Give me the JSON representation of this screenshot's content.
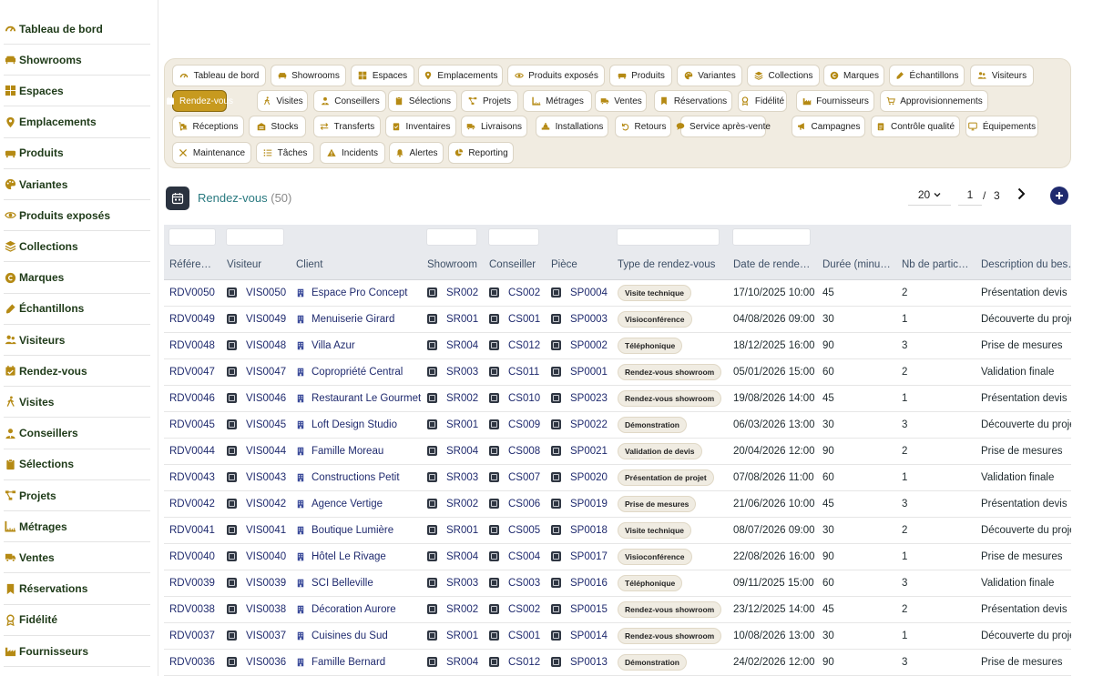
{
  "sidebar": {
    "items": [
      {
        "label": "Tableau de bord",
        "icon": "gauge-icon"
      },
      {
        "label": "Showrooms",
        "icon": "sofa-icon"
      },
      {
        "label": "Espaces",
        "icon": "grid-icon"
      },
      {
        "label": "Emplacements",
        "icon": "map-pin-icon"
      },
      {
        "label": "Produits",
        "icon": "couch-icon"
      },
      {
        "label": "Variantes",
        "icon": "palette-icon"
      },
      {
        "label": "Produits exposés",
        "icon": "eye-icon"
      },
      {
        "label": "Collections",
        "icon": "layers-icon"
      },
      {
        "label": "Marques",
        "icon": "copyright-icon"
      },
      {
        "label": "Échantillons",
        "icon": "eyedropper-icon"
      },
      {
        "label": "Visiteurs",
        "icon": "users-icon"
      },
      {
        "label": "Rendez-vous",
        "icon": "calendar-check-icon"
      },
      {
        "label": "Visites",
        "icon": "walking-icon"
      },
      {
        "label": "Conseillers",
        "icon": "user-tie-icon"
      },
      {
        "label": "Sélections",
        "icon": "clipboard-icon"
      },
      {
        "label": "Projets",
        "icon": "project-diagram-icon"
      },
      {
        "label": "Métrages",
        "icon": "ruler-icon"
      },
      {
        "label": "Ventes",
        "icon": "truck-icon"
      },
      {
        "label": "Réservations",
        "icon": "bookmark-icon"
      },
      {
        "label": "Fidélité",
        "icon": "award-icon"
      },
      {
        "label": "Fournisseurs",
        "icon": "industry-icon"
      }
    ]
  },
  "tabs": {
    "rows": [
      [
        {
          "label": "Tableau de bord",
          "icon": "gauge-icon"
        },
        {
          "label": "Showrooms",
          "icon": "sofa-icon"
        },
        {
          "label": "Espaces",
          "icon": "grid-icon"
        },
        {
          "label": "Emplacements",
          "icon": "map-pin-icon"
        },
        {
          "label": "Produits exposés",
          "icon": "eye-icon"
        },
        {
          "label": "Produits",
          "icon": "couch-icon"
        },
        {
          "label": "Variantes",
          "icon": "palette-icon"
        },
        {
          "label": "Collections",
          "icon": "layers-icon"
        },
        {
          "label": "Marques",
          "icon": "copyright-icon"
        },
        {
          "label": "Échantillons",
          "icon": "eyedropper-icon"
        },
        {
          "label": "Visiteurs",
          "icon": "users-icon"
        }
      ],
      [
        {
          "label": "Rendez-vous",
          "icon": "calendar-check-icon",
          "active": true
        },
        {
          "label": "Visites",
          "icon": "walking-icon"
        },
        {
          "label": "Conseillers",
          "icon": "user-tie-icon"
        },
        {
          "label": "Sélections",
          "icon": "clipboard-icon"
        },
        {
          "label": "Projets",
          "icon": "project-diagram-icon"
        },
        {
          "label": "Métrages",
          "icon": "ruler-icon"
        },
        {
          "label": "Ventes",
          "icon": "truck-icon"
        },
        {
          "label": "Réservations",
          "icon": "bookmark-icon"
        },
        {
          "label": "Fidélité",
          "icon": "award-icon"
        },
        {
          "label": "Fournisseurs",
          "icon": "industry-icon"
        },
        {
          "label": "Approvisionnements",
          "icon": "cart-icon"
        }
      ],
      [
        {
          "label": "Réceptions",
          "icon": "dolly-icon"
        },
        {
          "label": "Stocks",
          "icon": "warehouse-icon"
        },
        {
          "label": "Transferts",
          "icon": "exchange-icon"
        },
        {
          "label": "Inventaires",
          "icon": "clipboard-check-icon"
        },
        {
          "label": "Livraisons",
          "icon": "shipping-icon"
        },
        {
          "label": "Installations",
          "icon": "tools-icon"
        },
        {
          "label": "Retours",
          "icon": "undo-icon"
        },
        {
          "label": "Service après-vente",
          "icon": "comment-icon"
        },
        {
          "label": "Campagnes",
          "icon": "bullhorn-icon"
        },
        {
          "label": "Contrôle qualité",
          "icon": "clipboard-list-icon"
        },
        {
          "label": "Équipements",
          "icon": "monitor-icon"
        }
      ],
      [
        {
          "label": "Maintenance",
          "icon": "wrench-icon"
        },
        {
          "label": "Tâches",
          "icon": "tasks-icon"
        },
        {
          "label": "Incidents",
          "icon": "warning-icon"
        },
        {
          "label": "Alertes",
          "icon": "bell-icon"
        },
        {
          "label": "Reporting",
          "icon": "chart-pie-icon"
        }
      ]
    ]
  },
  "header": {
    "title": "Rendez-vous",
    "count": "(50)",
    "page_size": "20",
    "page": "1",
    "page_sep": "/",
    "total_pages": "3",
    "colors": {
      "accent": "#c79a1f",
      "title": "#2a7a80",
      "link": "#1f2a6e"
    }
  },
  "table": {
    "columns": [
      "Référence",
      "Visiteur",
      "Client",
      "Showroom",
      "Conseiller",
      "Pièce",
      "Type de rendez-vous",
      "Date de rende…",
      "Durée (minut…",
      "Nb de partici…",
      "Description du bes…"
    ],
    "rows": [
      {
        "ref": "RDV0050",
        "visiteur": "VIS0050",
        "client": "Espace Pro Concept",
        "showroom": "SR002",
        "conseiller": "CS002",
        "piece": "SP0004",
        "type": "Visite technique",
        "date": "17/10/2025 10:00",
        "duree": "45",
        "nb": "2",
        "desc": "Présentation devis"
      },
      {
        "ref": "RDV0049",
        "visiteur": "VIS0049",
        "client": "Menuiserie Girard",
        "showroom": "SR001",
        "conseiller": "CS001",
        "piece": "SP0003",
        "type": "Visioconférence",
        "date": "04/08/2026 09:00",
        "duree": "30",
        "nb": "1",
        "desc": "Découverte du projet"
      },
      {
        "ref": "RDV0048",
        "visiteur": "VIS0048",
        "client": "Villa Azur",
        "showroom": "SR004",
        "conseiller": "CS012",
        "piece": "SP0002",
        "type": "Téléphonique",
        "date": "18/12/2025 16:00",
        "duree": "90",
        "nb": "3",
        "desc": "Prise de mesures"
      },
      {
        "ref": "RDV0047",
        "visiteur": "VIS0047",
        "client": "Copropriété Central",
        "showroom": "SR003",
        "conseiller": "CS011",
        "piece": "SP0001",
        "type": "Rendez-vous showroom",
        "date": "05/01/2026 15:00",
        "duree": "60",
        "nb": "2",
        "desc": "Validation finale"
      },
      {
        "ref": "RDV0046",
        "visiteur": "VIS0046",
        "client": "Restaurant Le Gourmet",
        "showroom": "SR002",
        "conseiller": "CS010",
        "piece": "SP0023",
        "type": "Rendez-vous showroom",
        "date": "19/08/2026 14:00",
        "duree": "45",
        "nb": "1",
        "desc": "Présentation devis"
      },
      {
        "ref": "RDV0045",
        "visiteur": "VIS0045",
        "client": "Loft Design Studio",
        "showroom": "SR001",
        "conseiller": "CS009",
        "piece": "SP0022",
        "type": "Démonstration",
        "date": "06/03/2026 13:00",
        "duree": "30",
        "nb": "3",
        "desc": "Découverte du projet"
      },
      {
        "ref": "RDV0044",
        "visiteur": "VIS0044",
        "client": "Famille Moreau",
        "showroom": "SR004",
        "conseiller": "CS008",
        "piece": "SP0021",
        "type": "Validation de devis",
        "date": "20/04/2026 12:00",
        "duree": "90",
        "nb": "2",
        "desc": "Prise de mesures"
      },
      {
        "ref": "RDV0043",
        "visiteur": "VIS0043",
        "client": "Constructions Petit",
        "showroom": "SR003",
        "conseiller": "CS007",
        "piece": "SP0020",
        "type": "Présentation de projet",
        "date": "07/08/2026 11:00",
        "duree": "60",
        "nb": "1",
        "desc": "Validation finale"
      },
      {
        "ref": "RDV0042",
        "visiteur": "VIS0042",
        "client": "Agence Vertige",
        "showroom": "SR002",
        "conseiller": "CS006",
        "piece": "SP0019",
        "type": "Prise de mesures",
        "date": "21/06/2026 10:00",
        "duree": "45",
        "nb": "3",
        "desc": "Présentation devis"
      },
      {
        "ref": "RDV0041",
        "visiteur": "VIS0041",
        "client": "Boutique Lumière",
        "showroom": "SR001",
        "conseiller": "CS005",
        "piece": "SP0018",
        "type": "Visite technique",
        "date": "08/07/2026 09:00",
        "duree": "30",
        "nb": "2",
        "desc": "Découverte du projet"
      },
      {
        "ref": "RDV0040",
        "visiteur": "VIS0040",
        "client": "Hôtel Le Rivage",
        "showroom": "SR004",
        "conseiller": "CS004",
        "piece": "SP0017",
        "type": "Visioconférence",
        "date": "22/08/2026 16:00",
        "duree": "90",
        "nb": "1",
        "desc": "Prise de mesures"
      },
      {
        "ref": "RDV0039",
        "visiteur": "VIS0039",
        "client": "SCI Belleville",
        "showroom": "SR003",
        "conseiller": "CS003",
        "piece": "SP0016",
        "type": "Téléphonique",
        "date": "09/11/2025 15:00",
        "duree": "60",
        "nb": "3",
        "desc": "Validation finale"
      },
      {
        "ref": "RDV0038",
        "visiteur": "VIS0038",
        "client": "Décoration Aurore",
        "showroom": "SR002",
        "conseiller": "CS002",
        "piece": "SP0015",
        "type": "Rendez-vous showroom",
        "date": "23/12/2025 14:00",
        "duree": "45",
        "nb": "2",
        "desc": "Présentation devis"
      },
      {
        "ref": "RDV0037",
        "visiteur": "VIS0037",
        "client": "Cuisines du Sud",
        "showroom": "SR001",
        "conseiller": "CS001",
        "piece": "SP0014",
        "type": "Rendez-vous showroom",
        "date": "10/08/2026 13:00",
        "duree": "30",
        "nb": "1",
        "desc": "Découverte du projet"
      },
      {
        "ref": "RDV0036",
        "visiteur": "VIS0036",
        "client": "Famille Bernard",
        "showroom": "SR004",
        "conseiller": "CS012",
        "piece": "SP0013",
        "type": "Démonstration",
        "date": "24/02/2026 12:00",
        "duree": "90",
        "nb": "3",
        "desc": "Prise de mesures"
      }
    ]
  }
}
